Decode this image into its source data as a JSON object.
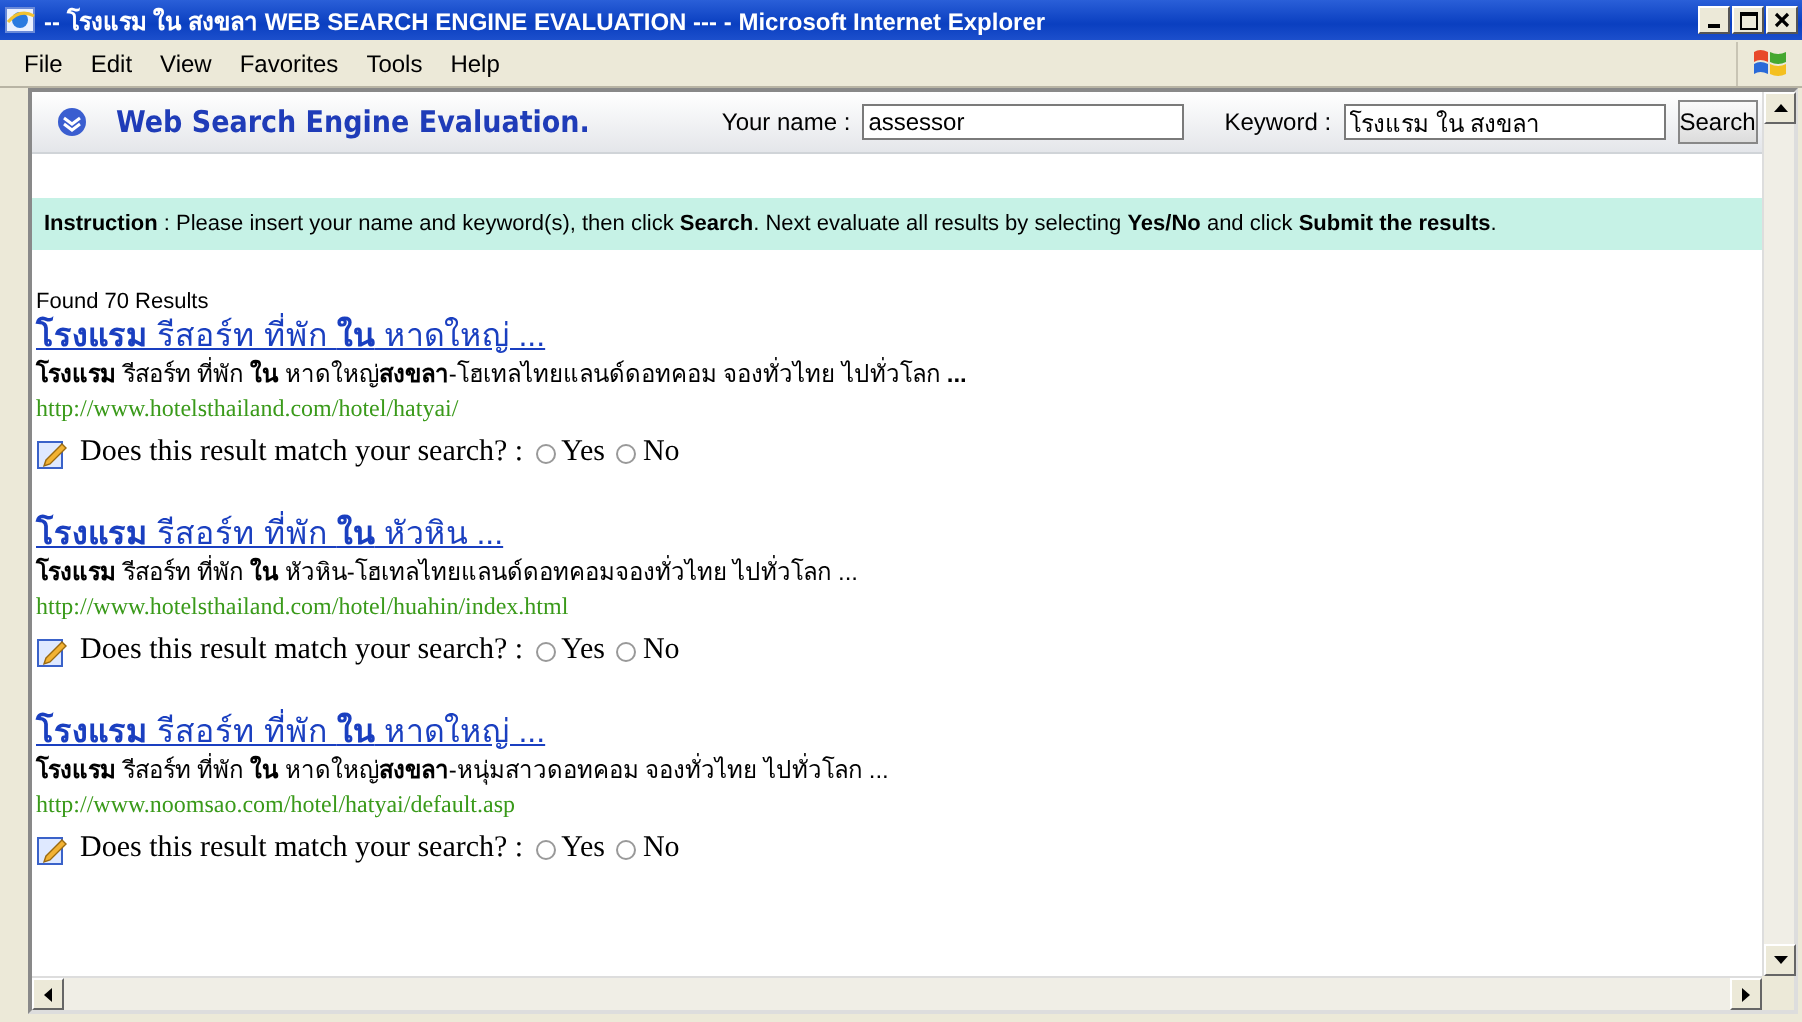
{
  "window": {
    "title": "-- โรงแรม ใน สงขลา WEB SEARCH ENGINE EVALUATION --- - Microsoft Internet Explorer"
  },
  "menu": [
    "File",
    "Edit",
    "View",
    "Favorites",
    "Tools",
    "Help"
  ],
  "header": {
    "title": "Web Search Engine Evaluation.",
    "name_label": "Your name :",
    "name_value": "assessor",
    "keyword_label": "Keyword :",
    "keyword_value": "โรงแรม ใน สงขลา",
    "search_button": "Search"
  },
  "instruction": "**Instruction** : Please insert your name and keyword(s), then click **Search**.  Next evaluate all results by selecting **Yes/No** and click **Submit the results**.",
  "results_count": "Found 70 Results",
  "results": [
    {
      "title": "**โรงแรม** รีสอร์ท ที่พัก **ใน** หาดใหญ่ ...",
      "snippet": "**โรงแรม** รีสอร์ท ที่พัก **ใน** หาดใหญ่**สงขลา**-โฮเทลไทยแลนด์ดอทคอม จองทั่วไทย ไปทั่วโลก **...**",
      "url": "http://www.hotelsthailand.com/hotel/hatyai/",
      "question": "Does this result match your search? :",
      "options": [
        {
          "label": "Yes",
          "selected": false
        },
        {
          "label": "No",
          "selected": false
        }
      ]
    },
    {
      "title": "**โรงแรม** รีสอร์ท ที่พัก **ใน** หัวหิน ...",
      "snippet": "**โรงแรม** รีสอร์ท ที่พัก **ใน** หัวหิน-โฮเทลไทยแลนด์ดอทคอมจองทั่วไทย ไปทั่วโลก ...",
      "url": "http://www.hotelsthailand.com/hotel/huahin/index.html",
      "question": "Does this result match your search? :",
      "options": [
        {
          "label": "Yes",
          "selected": false
        },
        {
          "label": "No",
          "selected": false
        }
      ]
    },
    {
      "title": "**โรงแรม** รีสอร์ท ที่พัก **ใน** หาดใหญ่ ...",
      "snippet": "**โรงแรม** รีสอร์ท ที่พัก **ใน** หาดใหญ่**สงขลา**-หนุ่มสาวดอทคอม จองทั่วไทย ไปทั่วโลก ...",
      "url": "http://www.noomsao.com/hotel/hatyai/default.asp",
      "question": "Does this result match your search? :",
      "options": [
        {
          "label": "Yes",
          "selected": false
        },
        {
          "label": "No",
          "selected": false
        }
      ]
    }
  ]
}
